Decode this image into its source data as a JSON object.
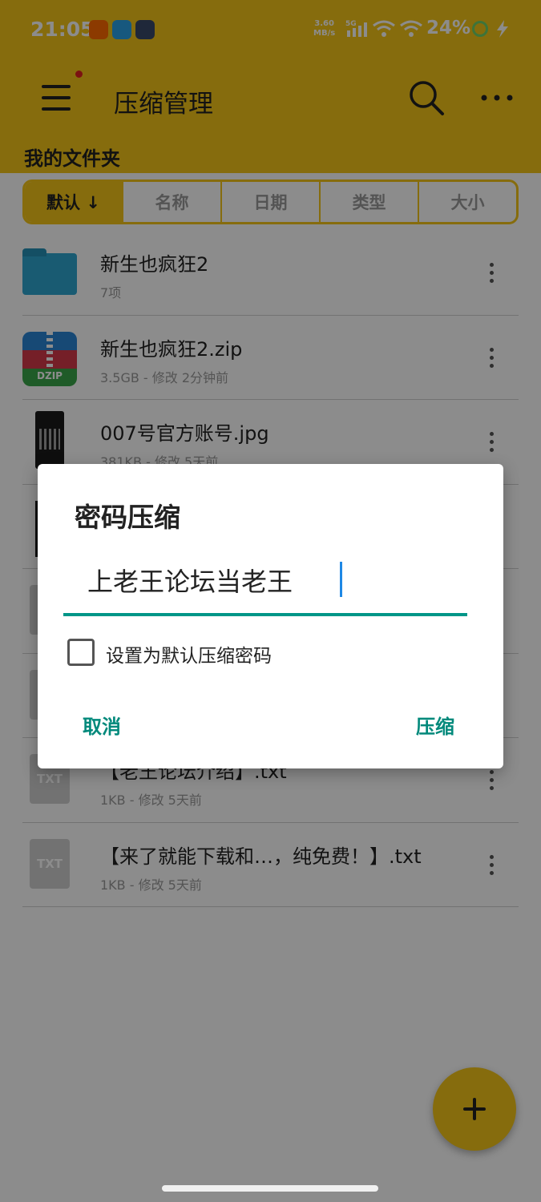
{
  "status_bar": {
    "time": "21:05",
    "net_speed": "3.60",
    "net_unit": "MB/s",
    "net_type": "5G",
    "battery": "24%"
  },
  "app_bar": {
    "title": "压缩管理",
    "menu_icon": "menu-icon",
    "search_icon": "search-icon",
    "more_icon": "more-horizontal-icon"
  },
  "folder_label": "我的文件夹",
  "sort_tabs": [
    {
      "label": "默认 ↓",
      "active": true
    },
    {
      "label": "名称",
      "active": false
    },
    {
      "label": "日期",
      "active": false
    },
    {
      "label": "类型",
      "active": false
    },
    {
      "label": "大小",
      "active": false
    }
  ],
  "files": [
    {
      "name": "新生也疯狂2",
      "meta": "7项",
      "icon": "folder-icon"
    },
    {
      "name": "新生也疯狂2.zip",
      "meta": "3.5GB - 修改 2分钟前",
      "icon": "zip-icon",
      "icon_label": "DZIP"
    },
    {
      "name": "007号官方账号.jpg",
      "meta": "381KB - 修改 5天前",
      "icon": "image-icon"
    },
    {
      "name": "",
      "meta": "",
      "icon": "image-icon"
    },
    {
      "name": "",
      "meta": "",
      "icon": "file-icon"
    },
    {
      "name": "",
      "meta": "",
      "icon": "file-icon"
    },
    {
      "name": "【老王论坛介绍】.txt",
      "meta": "1KB - 修改 5天前",
      "icon": "txt-icon",
      "icon_label": "TXT"
    },
    {
      "name": "【来了就能下载和…，纯免费！】.txt",
      "meta": "1KB - 修改 5天前",
      "icon": "txt-icon",
      "icon_label": "TXT"
    }
  ],
  "dialog": {
    "title": "密码压缩",
    "password": "上老王论坛当老王",
    "checkbox_label": "设置为默认压缩密码",
    "checkbox_checked": false,
    "cancel_label": "取消",
    "confirm_label": "压缩"
  },
  "fab_icon": "plus-icon",
  "colors": {
    "brand": "#f5c518",
    "accent": "#009688",
    "scrim": "rgba(0,0,0,0.45)"
  }
}
